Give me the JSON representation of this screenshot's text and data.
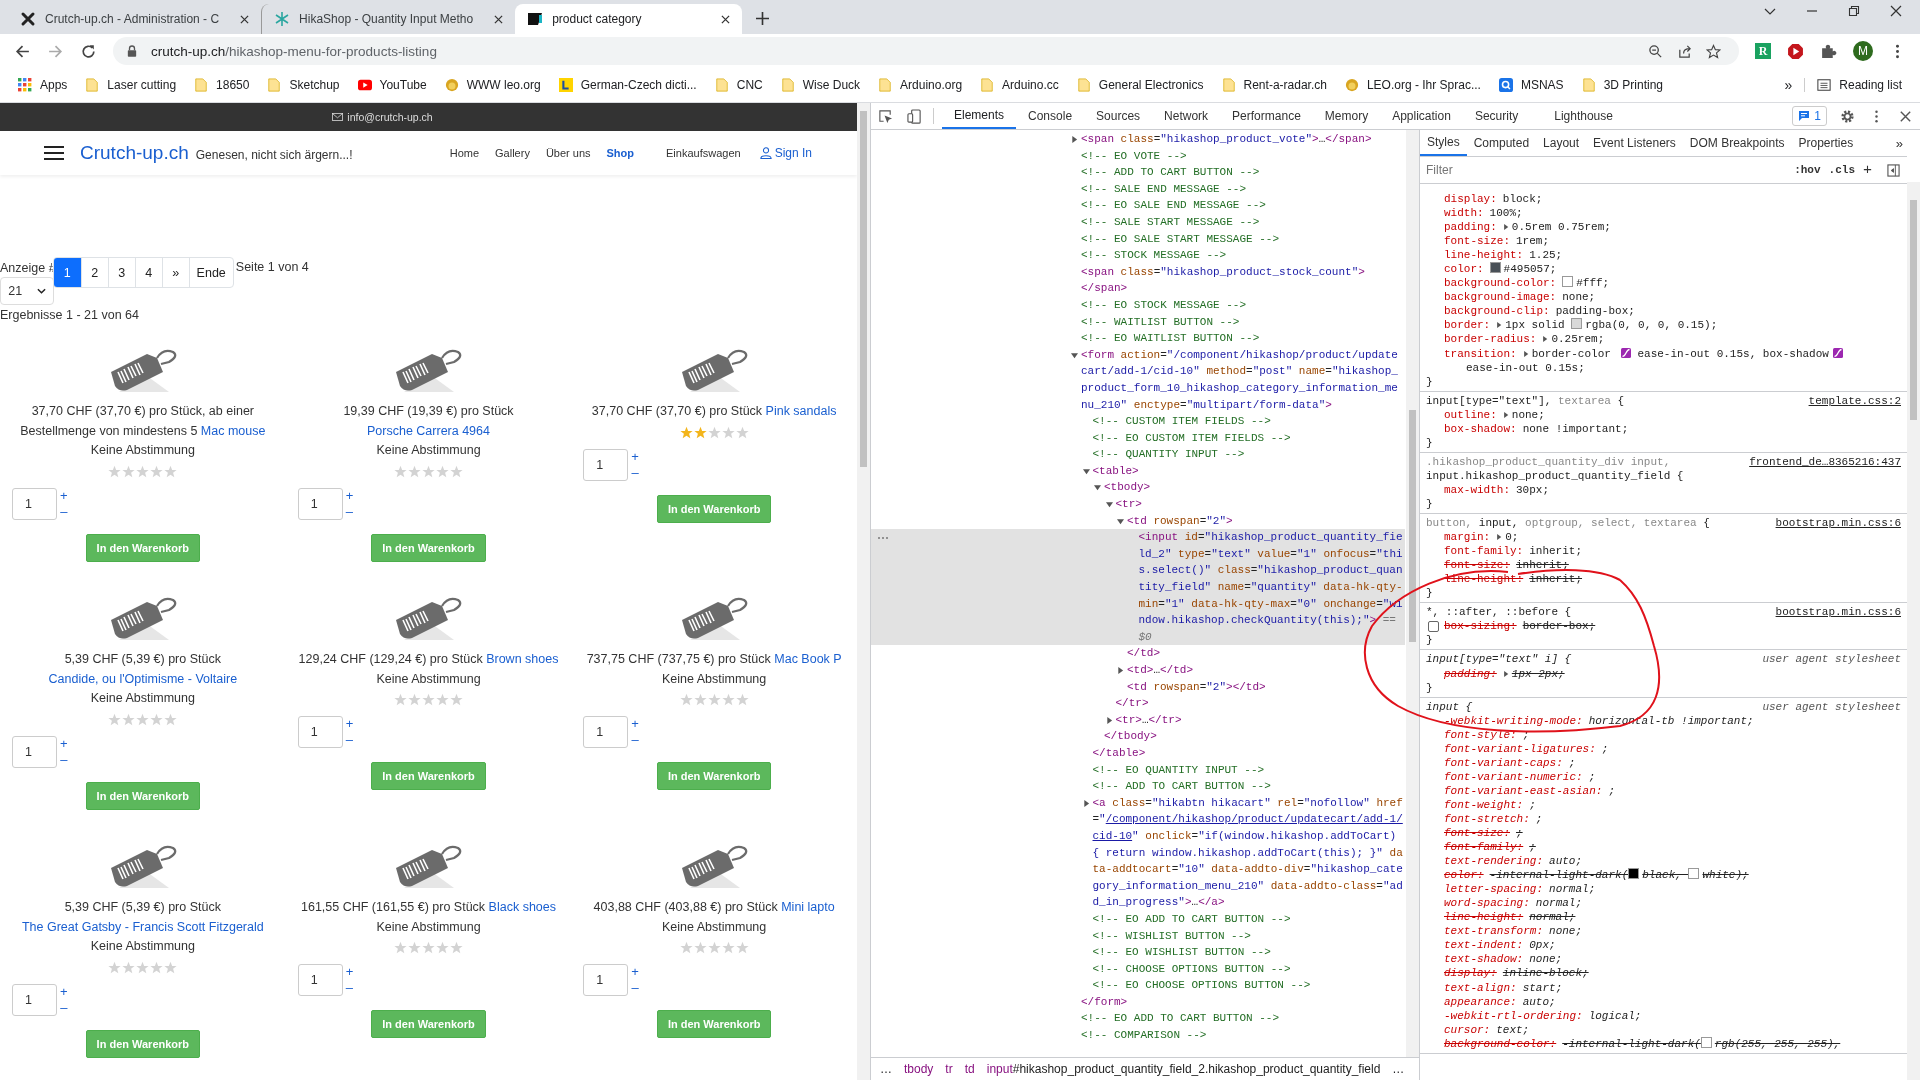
{
  "browser": {
    "tabs": [
      {
        "title": "Crutch-up.ch - Administration - C",
        "kind": "joomla",
        "selected": false
      },
      {
        "title": "HikaShop - Quantity Input Metho",
        "kind": "hikashop",
        "selected": false
      },
      {
        "title": "product category",
        "kind": "cu",
        "selected": true
      }
    ],
    "url": {
      "host": "crutch-up.ch",
      "path": "/hikashop-menu-for-products-listing"
    },
    "extension_label": "R",
    "profile_initial": "M",
    "bookmarks": [
      {
        "label": "Apps",
        "kind": "apps"
      },
      {
        "label": "Laser cutting",
        "kind": "folder"
      },
      {
        "label": "18650",
        "kind": "folder"
      },
      {
        "label": "Sketchup",
        "kind": "folder"
      },
      {
        "label": "YouTube",
        "kind": "youtube"
      },
      {
        "label": "WWW leo.org",
        "kind": "leo"
      },
      {
        "label": "German-Czech dicti...",
        "kind": "dict"
      },
      {
        "label": "CNC",
        "kind": "folder"
      },
      {
        "label": "Wise Duck",
        "kind": "folder"
      },
      {
        "label": "Arduino.org",
        "kind": "folder"
      },
      {
        "label": "Arduino.cc",
        "kind": "folder"
      },
      {
        "label": "General Electronics",
        "kind": "folder"
      },
      {
        "label": "Rent-a-radar.ch",
        "kind": "folder"
      },
      {
        "label": "LEO.org - Ihr Sprac...",
        "kind": "leo"
      },
      {
        "label": "MSNAS",
        "kind": "msnas"
      },
      {
        "label": "3D Printing",
        "kind": "folder"
      }
    ],
    "bookmarks_more": "»",
    "reading_list": "Reading list"
  },
  "page": {
    "contact_email": "info@crutch-up.ch",
    "brand": "Crutch-up.ch",
    "tagline": "Genesen, nicht sich ärgern...!",
    "nav": [
      {
        "label": "Home",
        "selected": false
      },
      {
        "label": "Gallery",
        "selected": false
      },
      {
        "label": "Über uns",
        "selected": false
      },
      {
        "label": "Shop",
        "selected": true
      },
      {
        "label": "Einkaufswagen",
        "selected": false
      }
    ],
    "sign_in": "Sign In",
    "display_label": "Anzeige #",
    "pagination": [
      {
        "label": "1",
        "selected": true
      },
      {
        "label": "2",
        "selected": false
      },
      {
        "label": "3",
        "selected": false
      },
      {
        "label": "4",
        "selected": false
      },
      {
        "label": "»",
        "selected": false
      },
      {
        "label": "Ende",
        "selected": false
      }
    ],
    "page_info": "Seite 1 von 4",
    "per_page": "21",
    "results": "Ergebnisse 1 - 21 von 64",
    "products": [
      {
        "price": "37,70 CHF (37,70 €) pro Stück, ab einer Bestellmenge von mindestens 5",
        "name": "Mac mouse",
        "rating_text": "Keine Abstimmung",
        "stars": 0,
        "quantity": "1",
        "increment": "+",
        "decrement": "–",
        "button": "In den Warenkorb"
      },
      {
        "price": "19,39 CHF (19,39 €) pro Stück",
        "name": "Porsche Carrera 4964",
        "rating_text": "Keine Abstimmung",
        "stars": 0,
        "quantity": "1",
        "increment": "+",
        "decrement": "–",
        "button": "In den Warenkorb"
      },
      {
        "price": "37,70 CHF (37,70 €) pro Stück",
        "name": "Pink sandals",
        "stars": 2,
        "quantity": "1",
        "increment": "+",
        "decrement": "–",
        "button": "In den Warenkorb"
      },
      {
        "price": "5,39 CHF (5,39 €) pro Stück",
        "name": "Candide, ou l'Optimisme - Voltaire",
        "rating_text": "Keine Abstimmung",
        "stars": 0,
        "quantity": "1",
        "increment": "+",
        "decrement": "–",
        "button": "In den Warenkorb"
      },
      {
        "price": "129,24 CHF (129,24 €) pro Stück",
        "name": "Brown shoes",
        "rating_text": "Keine Abstimmung",
        "stars": 0,
        "quantity": "1",
        "increment": "+",
        "decrement": "–",
        "button": "In den Warenkorb"
      },
      {
        "price": "737,75 CHF (737,75 €) pro Stück",
        "name": "Mac Book P",
        "rating_text": "Keine Abstimmung",
        "stars": 0,
        "quantity": "1",
        "increment": "+",
        "decrement": "–",
        "button": "In den Warenkorb"
      },
      {
        "price": "5,39 CHF (5,39 €) pro Stück",
        "name": "The Great Gatsby - Francis Scott Fitzgerald",
        "rating_text": "Keine Abstimmung",
        "stars": 0,
        "quantity": "1",
        "increment": "+",
        "decrement": "–",
        "button": "In den Warenkorb"
      },
      {
        "price": "161,55 CHF (161,55 €) pro Stück",
        "name": "Black shoes",
        "rating_text": "Keine Abstimmung",
        "stars": 0,
        "quantity": "1",
        "increment": "+",
        "decrement": "–",
        "button": "In den Warenkorb"
      },
      {
        "price": "403,88 CHF (403,88 €) pro Stück",
        "name": "Mini lapto",
        "rating_text": "Keine Abstimmung",
        "stars": 0,
        "quantity": "1",
        "increment": "+",
        "decrement": "–",
        "button": "In den Warenkorb"
      }
    ]
  },
  "devtools": {
    "tabs": [
      {
        "label": "Elements",
        "selected": true
      },
      {
        "label": "Console",
        "selected": false
      },
      {
        "label": "Sources",
        "selected": false
      },
      {
        "label": "Network",
        "selected": false
      },
      {
        "label": "Performance",
        "selected": false
      },
      {
        "label": "Memory",
        "selected": false
      },
      {
        "label": "Application",
        "selected": false
      },
      {
        "label": "Security",
        "selected": false
      },
      {
        "label": "Lighthouse",
        "selected": false
      }
    ],
    "issues_count": "1",
    "elements": {
      "tree": [
        {
          "kind": "element",
          "selected": false,
          "expanded": false,
          "parts": [
            {
              "kind": "tag",
              "text": "<span"
            },
            {
              "kind": "attr",
              "text": " class"
            },
            {
              "kind": "punct",
              "text": "="
            },
            {
              "kind": "value",
              "text": "\"hikashop_product_vote\""
            },
            {
              "kind": "tag",
              "text": ">"
            },
            {
              "kind": "punct",
              "text": "…"
            },
            {
              "kind": "tag",
              "text": "</span>"
            }
          ]
        },
        {
          "kind": "comment",
          "selected": false,
          "text": "<!-- EO VOTE -->"
        },
        {
          "kind": "comment",
          "selected": false,
          "text": "<!-- ADD TO CART BUTTON -->"
        },
        {
          "kind": "comment",
          "selected": false,
          "text": "<!-- SALE END MESSAGE -->"
        },
        {
          "kind": "comment",
          "selected": false,
          "text": "<!-- EO SALE END MESSAGE -->"
        },
        {
          "kind": "comment",
          "selected": false,
          "text": "<!-- SALE START MESSAGE -->"
        },
        {
          "kind": "comment",
          "selected": false,
          "text": "<!-- EO SALE START MESSAGE -->"
        },
        {
          "kind": "comment",
          "selected": false,
          "text": "<!-- STOCK MESSAGE -->"
        },
        {
          "kind": "element",
          "selected": false,
          "parts": [
            {
              "kind": "tag",
              "text": "<span"
            },
            {
              "kind": "attr",
              "text": " class"
            },
            {
              "kind": "punct",
              "text": "="
            },
            {
              "kind": "value",
              "text": "\"hikashop_product_stock_count\""
            },
            {
              "kind": "tag",
              "text": ">"
            }
          ],
          "close": "</span>"
        },
        {
          "kind": "comment",
          "selected": false,
          "text": "<!-- EO STOCK MESSAGE -->"
        },
        {
          "kind": "comment",
          "selected": false,
          "text": "<!-- WAITLIST BUTTON -->"
        },
        {
          "kind": "comment",
          "selected": false,
          "text": "<!-- EO WAITLIST BUTTON -->"
        },
        {
          "kind": "element",
          "selected": false,
          "expanded": true,
          "parts": [
            {
              "kind": "tag",
              "text": "<form"
            },
            {
              "kind": "attr",
              "text": " action"
            },
            {
              "kind": "punct",
              "text": "="
            },
            {
              "kind": "value",
              "text": "\"/component/hikashop/product/updatecart/add-1/cid-10\""
            },
            {
              "kind": "attr",
              "text": " method"
            },
            {
              "kind": "punct",
              "text": "="
            },
            {
              "kind": "value",
              "text": "\"post\""
            },
            {
              "kind": "attr",
              "text": " name"
            },
            {
              "kind": "punct",
              "text": "="
            },
            {
              "kind": "value",
              "text": "\"hikashop_product_form_10_hikashop_category_information_menu_210\""
            },
            {
              "kind": "attr",
              "text": " enctype"
            },
            {
              "kind": "punct",
              "text": "="
            },
            {
              "kind": "value",
              "text": "\"multipart/form-data\""
            },
            {
              "kind": "tag",
              "text": ">"
            }
          ],
          "close": "</form>",
          "children": [
            {
              "kind": "comment",
              "selected": false,
              "text": "<!-- CUSTOM ITEM FIELDS -->"
            },
            {
              "kind": "comment",
              "selected": false,
              "text": "<!-- EO CUSTOM ITEM FIELDS -->"
            },
            {
              "kind": "comment",
              "selected": false,
              "text": "<!-- QUANTITY INPUT -->"
            },
            {
              "kind": "element",
              "selected": false,
              "expanded": true,
              "parts": [
                {
                  "kind": "tag",
                  "text": "<table>"
                }
              ],
              "close": "</table>",
              "children": [
                {
                  "kind": "element",
                  "selected": false,
                  "expanded": true,
                  "parts": [
                    {
                      "kind": "tag",
                      "text": "<tbody>"
                    }
                  ],
                  "close": "</tbody>",
                  "children": [
                    {
                      "kind": "element",
                      "selected": false,
                      "expanded": true,
                      "parts": [
                        {
                          "kind": "tag",
                          "text": "<tr>"
                        }
                      ],
                      "close": "</tr>",
                      "children": [
                        {
                          "kind": "element",
                          "selected": false,
                          "expanded": true,
                          "parts": [
                            {
                              "kind": "tag",
                              "text": "<td"
                            },
                            {
                              "kind": "attr",
                              "text": " rowspan"
                            },
                            {
                              "kind": "punct",
                              "text": "="
                            },
                            {
                              "kind": "value",
                              "text": "\"2\""
                            },
                            {
                              "kind": "tag",
                              "text": ">"
                            }
                          ],
                          "close": "</td>",
                          "children": [
                            {
                              "kind": "element",
                              "selected": true,
                              "parts": [
                                {
                                  "kind": "tag",
                                  "text": "<input"
                                },
                                {
                                  "kind": "attr",
                                  "text": " id"
                                },
                                {
                                  "kind": "punct",
                                  "text": "="
                                },
                                {
                                  "kind": "value",
                                  "text": "\"hikashop_product_quantity_field_2\""
                                },
                                {
                                  "kind": "attr",
                                  "text": " type"
                                },
                                {
                                  "kind": "punct",
                                  "text": "="
                                },
                                {
                                  "kind": "value",
                                  "text": "\"text\""
                                },
                                {
                                  "kind": "attr",
                                  "text": " value"
                                },
                                {
                                  "kind": "punct",
                                  "text": "="
                                },
                                {
                                  "kind": "value",
                                  "text": "\"1\""
                                },
                                {
                                  "kind": "attr",
                                  "text": " onfocus"
                                },
                                {
                                  "kind": "punct",
                                  "text": "="
                                },
                                {
                                  "kind": "value",
                                  "text": "\"this.select()\""
                                },
                                {
                                  "kind": "attr",
                                  "text": " class"
                                },
                                {
                                  "kind": "punct",
                                  "text": "="
                                },
                                {
                                  "kind": "value",
                                  "text": "\"hikashop_product_quantity_field\""
                                },
                                {
                                  "kind": "attr",
                                  "text": " name"
                                },
                                {
                                  "kind": "punct",
                                  "text": "="
                                },
                                {
                                  "kind": "value",
                                  "text": "\"quantity\""
                                },
                                {
                                  "kind": "attr",
                                  "text": " data-hk-qty-min"
                                },
                                {
                                  "kind": "punct",
                                  "text": "="
                                },
                                {
                                  "kind": "value",
                                  "text": "\"1\""
                                },
                                {
                                  "kind": "attr",
                                  "text": " data-hk-qty-max"
                                },
                                {
                                  "kind": "punct",
                                  "text": "="
                                },
                                {
                                  "kind": "value",
                                  "text": "\"0\""
                                },
                                {
                                  "kind": "attr",
                                  "text": " onchange"
                                },
                                {
                                  "kind": "punct",
                                  "text": "="
                                },
                                {
                                  "kind": "value",
                                  "text": "\"window.hikashop.checkQuantity(this);\""
                                },
                                {
                                  "kind": "tag",
                                  "text": ">"
                                },
                                {
                                  "kind": "marker",
                                  "text": " == $0"
                                }
                              ]
                            }
                          ]
                        },
                        {
                          "kind": "element",
                          "selected": false,
                          "expanded": false,
                          "parts": [
                            {
                              "kind": "tag",
                              "text": "<td>"
                            },
                            {
                              "kind": "punct",
                              "text": "…"
                            },
                            {
                              "kind": "tag",
                              "text": "</td>"
                            }
                          ]
                        },
                        {
                          "kind": "element",
                          "selected": false,
                          "parts": [
                            {
                              "kind": "tag",
                              "text": "<td"
                            },
                            {
                              "kind": "attr",
                              "text": " rowspan"
                            },
                            {
                              "kind": "punct",
                              "text": "="
                            },
                            {
                              "kind": "value",
                              "text": "\"2\""
                            },
                            {
                              "kind": "tag",
                              "text": "></td>"
                            }
                          ]
                        }
                      ]
                    },
                    {
                      "kind": "element",
                      "selected": false,
                      "expanded": false,
                      "parts": [
                        {
                          "kind": "tag",
                          "text": "<tr>"
                        },
                        {
                          "kind": "punct",
                          "text": "…"
                        },
                        {
                          "kind": "tag",
                          "text": "</tr>"
                        }
                      ]
                    }
                  ]
                }
              ]
            },
            {
              "kind": "comment",
              "selected": false,
              "text": "<!-- EO QUANTITY INPUT -->"
            },
            {
              "kind": "comment",
              "selected": false,
              "text": "<!-- ADD TO CART BUTTON -->"
            },
            {
              "kind": "element",
              "selected": false,
              "expanded": false,
              "parts": [
                {
                  "kind": "tag",
                  "text": "<a"
                },
                {
                  "kind": "attr",
                  "text": " class"
                },
                {
                  "kind": "punct",
                  "text": "="
                },
                {
                  "kind": "value",
                  "text": "\"hikabtn hikacart\""
                },
                {
                  "kind": "attr",
                  "text": " rel"
                },
                {
                  "kind": "punct",
                  "text": "="
                },
                {
                  "kind": "value",
                  "text": "\"nofollow\""
                },
                {
                  "kind": "attr",
                  "text": " href"
                },
                {
                  "kind": "punct",
                  "text": "="
                },
                {
                  "kind": "value",
                  "text": "\""
                },
                {
                  "kind": "link",
                  "text": "/component/hikashop/product/updatecart/add-1/cid-10"
                },
                {
                  "kind": "value",
                  "text": "\""
                },
                {
                  "kind": "attr",
                  "text": " onclick"
                },
                {
                  "kind": "punct",
                  "text": "="
                },
                {
                  "kind": "value",
                  "text": "\"if(window.hikashop.addToCart) { return window.hikashop.addToCart(this); }\""
                },
                {
                  "kind": "attr",
                  "text": " data-addtocart"
                },
                {
                  "kind": "punct",
                  "text": "="
                },
                {
                  "kind": "value",
                  "text": "\"10\""
                },
                {
                  "kind": "attr",
                  "text": " data-addto-div"
                },
                {
                  "kind": "punct",
                  "text": "="
                },
                {
                  "kind": "value",
                  "text": "\"hikashop_category_information_menu_210\""
                },
                {
                  "kind": "attr",
                  "text": " data-addto-class"
                },
                {
                  "kind": "punct",
                  "text": "="
                },
                {
                  "kind": "value",
                  "text": "\"add_in_progress\""
                },
                {
                  "kind": "tag",
                  "text": ">"
                },
                {
                  "kind": "punct",
                  "text": "…"
                },
                {
                  "kind": "tag",
                  "text": "</a>"
                }
              ]
            },
            {
              "kind": "comment",
              "selected": false,
              "text": "<!-- EO ADD TO CART BUTTON -->"
            },
            {
              "kind": "comment",
              "selected": false,
              "text": "<!-- WISHLIST BUTTON -->"
            },
            {
              "kind": "comment",
              "selected": false,
              "text": "<!-- EO WISHLIST BUTTON -->"
            },
            {
              "kind": "comment",
              "selected": false,
              "text": "<!-- CHOOSE OPTIONS BUTTON -->"
            },
            {
              "kind": "comment",
              "selected": false,
              "text": "<!-- EO CHOOSE OPTIONS BUTTON -->"
            }
          ]
        },
        {
          "kind": "comment",
          "selected": false,
          "text": "<!-- EO ADD TO CART BUTTON -->"
        },
        {
          "kind": "comment",
          "selected": false,
          "text": "<!-- COMPARISON -->"
        }
      ],
      "breadcrumbs": [
        {
          "kind": "more",
          "text": "…"
        },
        {
          "kind": "tag",
          "tag": "tbody"
        },
        {
          "kind": "tag",
          "tag": "tr"
        },
        {
          "kind": "tag",
          "tag": "td"
        },
        {
          "kind": "tag",
          "tag": "input",
          "rest": "#hikashop_product_quantity_field_2.hikashop_product_quantity_field"
        },
        {
          "kind": "more",
          "text": "…"
        }
      ]
    },
    "styles": {
      "tabs": [
        {
          "label": "Styles",
          "selected": true
        },
        {
          "label": "Computed",
          "selected": false
        },
        {
          "label": "Layout",
          "selected": false
        },
        {
          "label": "Event Listeners",
          "selected": false
        },
        {
          "label": "DOM Breakpoints",
          "selected": false
        },
        {
          "label": "Properties",
          "selected": false
        }
      ],
      "more": "»",
      "filter_placeholder": "Filter",
      "hov": ":hov",
      "cls": ".cls",
      "add": "+",
      "rules": [
        {
          "kind": "author",
          "declarations": [
            {
              "prop": "display:",
              "value": "block;",
              "struck": false
            },
            {
              "prop": "width:",
              "value": "100%;",
              "struck": false
            },
            {
              "prop": "padding:",
              "expandable": true,
              "value": "0.5rem 0.75rem;",
              "struck": false
            },
            {
              "prop": "font-size:",
              "value": "1rem;",
              "struck": false
            },
            {
              "prop": "line-height:",
              "value": "1.25;",
              "struck": false
            },
            {
              "prop": "color:",
              "value": [
                {
                  "kind": "swatch",
                  "color": "#495057"
                },
                {
                  "kind": "text",
                  "text": "#495057;"
                }
              ],
              "struck": false
            },
            {
              "prop": "background-color:",
              "value": [
                {
                  "kind": "swatch",
                  "color": "#ffffff"
                },
                {
                  "kind": "text",
                  "text": "#fff;"
                }
              ],
              "struck": false
            },
            {
              "prop": "background-image:",
              "value": "none;",
              "struck": false
            },
            {
              "prop": "background-clip:",
              "value": "padding-box;",
              "struck": false
            },
            {
              "prop": "border:",
              "expandable": true,
              "value": [
                {
                  "kind": "text",
                  "text": "1px solid "
                },
                {
                  "kind": "swatch",
                  "color": "#d9d9d9"
                },
                {
                  "kind": "text",
                  "text": "rgba(0, 0, 0, 0.15);"
                }
              ],
              "struck": false
            },
            {
              "prop": "border-radius:",
              "expandable": true,
              "value": "0.25rem;",
              "struck": false
            },
            {
              "prop": "transition:",
              "expandable": true,
              "value": [
                {
                  "kind": "text",
                  "text": "border-color "
                },
                {
                  "kind": "easing"
                },
                {
                  "kind": "text",
                  "text": "ease-in-out 0.15s, box-shadow"
                },
                {
                  "kind": "easing"
                },
                {
                  "kind": "text",
                  "text": "ease-in-out 0.15s;"
                }
              ],
              "struck": false
            }
          ],
          "close": "}"
        },
        {
          "kind": "author",
          "selector": [
            {
              "text": "input[type=\"text\"],",
              "matched": true
            },
            {
              "text": " textarea",
              "matched": false
            },
            {
              "text": " {",
              "matched": true
            }
          ],
          "source": "template.css:2",
          "declarations": [
            {
              "prop": "outline:",
              "expandable": true,
              "value": "none;",
              "struck": false
            },
            {
              "prop": "box-shadow:",
              "value": "none !important;",
              "struck": false
            }
          ],
          "close": "}"
        },
        {
          "kind": "author",
          "selector": [
            {
              "text": ".hikashop_product_quantity_div input,",
              "matched": false
            },
            {
              "text": " input.hikashop_product_quantity_field",
              "matched": true
            },
            {
              "text": " {",
              "matched": true
            }
          ],
          "source": "frontend_de…8365216:437",
          "declarations": [
            {
              "prop": "max-width:",
              "value": "30px;",
              "struck": false
            }
          ],
          "close": "}"
        },
        {
          "kind": "author",
          "selector": [
            {
              "text": "button,",
              "matched": false
            },
            {
              "text": " input,",
              "matched": true
            },
            {
              "text": " optgroup, select, textarea",
              "matched": false
            },
            {
              "text": " {",
              "matched": true
            }
          ],
          "source": "bootstrap.min.css:6",
          "declarations": [
            {
              "prop": "margin:",
              "expandable": true,
              "value": "0;",
              "struck": false
            },
            {
              "prop": "font-family:",
              "value": "inherit;",
              "struck": false
            },
            {
              "prop": "font-size:",
              "value": "inherit;",
              "struck": true
            },
            {
              "prop": "line-height:",
              "value": "inherit;",
              "struck": true
            }
          ],
          "close": "}"
        },
        {
          "kind": "author",
          "selector": [
            {
              "text": "*, ::after, ::before {",
              "matched": true
            }
          ],
          "source": "bootstrap.min.css:6",
          "declarations": [
            {
              "prop": "box-sizing:",
              "value": "border-box;",
              "struck": true,
              "checked": false
            }
          ],
          "close": "}"
        },
        {
          "kind": "agent",
          "selector": [
            {
              "text": "input[type=\"text\" i] {",
              "matched": true
            }
          ],
          "source": "user agent stylesheet",
          "declarations": [
            {
              "prop": "padding:",
              "expandable": true,
              "value": "1px 2px;",
              "struck": true
            }
          ],
          "close": "}"
        },
        {
          "kind": "agent",
          "selector": [
            {
              "text": "input {",
              "matched": true
            }
          ],
          "source": "user agent stylesheet",
          "declarations": [
            {
              "prop": "-webkit-writing-mode:",
              "value": "horizontal-tb !important;",
              "struck": false
            },
            {
              "prop": "font-style:",
              "value": ";",
              "struck": false
            },
            {
              "prop": "font-variant-ligatures:",
              "value": ";",
              "struck": false
            },
            {
              "prop": "font-variant-caps:",
              "value": ";",
              "struck": false
            },
            {
              "prop": "font-variant-numeric:",
              "value": ";",
              "struck": false
            },
            {
              "prop": "font-variant-east-asian:",
              "value": ";",
              "struck": false
            },
            {
              "prop": "font-weight:",
              "value": ";",
              "struck": false
            },
            {
              "prop": "font-stretch:",
              "value": ";",
              "struck": false
            },
            {
              "prop": "font-size:",
              "value": ";",
              "struck": true
            },
            {
              "prop": "font-family:",
              "value": ";",
              "struck": true
            },
            {
              "prop": "text-rendering:",
              "value": "auto;",
              "struck": false
            },
            {
              "prop": "color:",
              "value": [
                {
                  "kind": "text",
                  "text": "-internal-light-dark("
                },
                {
                  "kind": "swatch",
                  "color": "#000000"
                },
                {
                  "kind": "text",
                  "text": "black, "
                },
                {
                  "kind": "swatch",
                  "color": "#ffffff"
                },
                {
                  "kind": "text",
                  "text": "white);"
                }
              ],
              "struck": true
            },
            {
              "prop": "letter-spacing:",
              "value": "normal;",
              "struck": false
            },
            {
              "prop": "word-spacing:",
              "value": "normal;",
              "struck": false
            },
            {
              "prop": "line-height:",
              "value": "normal;",
              "struck": true
            },
            {
              "prop": "text-transform:",
              "value": "none;",
              "struck": false
            },
            {
              "prop": "text-indent:",
              "value": "0px;",
              "struck": false
            },
            {
              "prop": "text-shadow:",
              "value": "none;",
              "struck": false
            },
            {
              "prop": "display:",
              "value": "inline-block;",
              "struck": true
            },
            {
              "prop": "text-align:",
              "value": "start;",
              "struck": false
            },
            {
              "prop": "appearance:",
              "value": "auto;",
              "struck": false
            },
            {
              "prop": "-webkit-rtl-ordering:",
              "value": "logical;",
              "struck": false
            },
            {
              "prop": "cursor:",
              "value": "text;",
              "struck": false
            },
            {
              "prop": "background-color:",
              "value": [
                {
                  "kind": "text",
                  "text": "-internal-light-dark("
                },
                {
                  "kind": "swatch",
                  "color": "#ffffff"
                },
                {
                  "kind": "text",
                  "text": "rgb(255, 255, 255),"
                }
              ],
              "struck": true
            }
          ]
        }
      ]
    }
  }
}
